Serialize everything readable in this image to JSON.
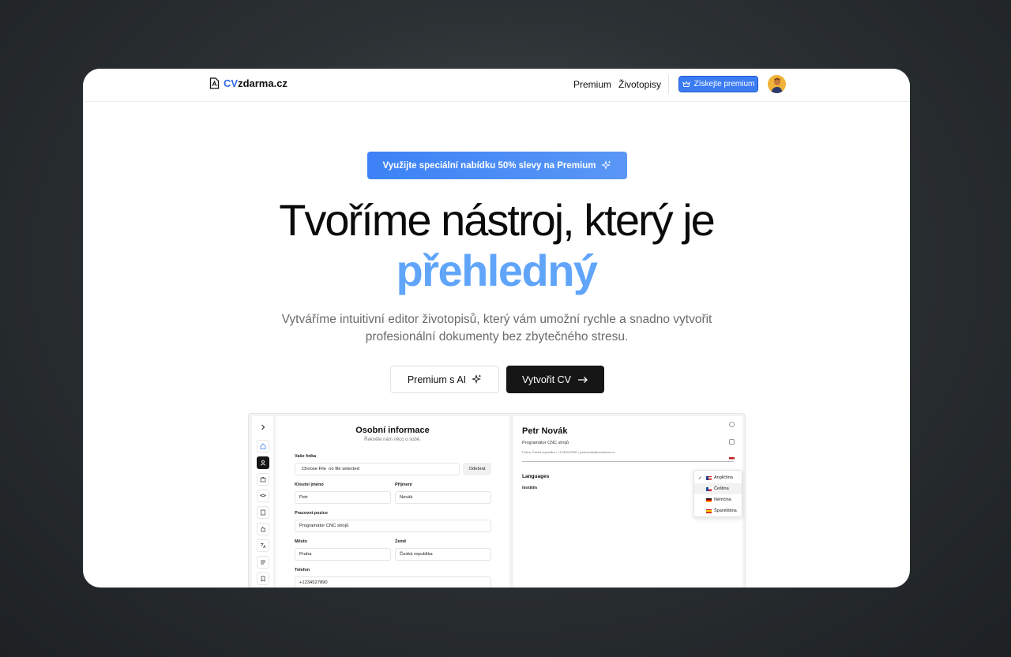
{
  "header": {
    "logo_prefix": "CV",
    "logo_suffix": "zdarma.cz",
    "nav": [
      "Premium",
      "Životopisy"
    ],
    "premium_button": "Získejte premium",
    "colors": {
      "brand": "#2f6ae6",
      "premium_button": "#3b7cf3"
    }
  },
  "hero": {
    "promo": "Využijte speciální nabídku 50% slevy na Premium",
    "headline_line1": "Tvoříme nástroj, který je",
    "headline_line2": "přehledný",
    "subtext": "Vytváříme intuitivní editor životopisů, který vám umožní rychle a snadno vytvořit profesionální dokumenty bez zbytečného stresu.",
    "cta_secondary": "Premium s AI",
    "cta_primary": "Vytvořit CV",
    "accent_color": "#60a5fa"
  },
  "editor": {
    "sidebar_icons": [
      "chevron-right-icon",
      "home-icon",
      "person-icon",
      "briefcase-icon",
      "graduation-cap-icon",
      "document-icon",
      "hand-icon",
      "translate-icon",
      "lines-icon",
      "bookmark-icon"
    ],
    "form_title": "Osobní informace",
    "form_subtitle": "Řekněte nám něco o sobě.",
    "photo_label": "Vaše fotka",
    "choose_file": "Choose File",
    "no_file": "no file selected",
    "remove": "Odebrat",
    "first_name_label": "Křestní jméno",
    "first_name_value": "Petr",
    "last_name_label": "Příjmení",
    "last_name_value": "Novák",
    "position_label": "Pracovní pozice",
    "position_value": "Programátor CNC strojů",
    "city_label": "Město",
    "city_value": "Praha",
    "country_label": "Země",
    "country_value": "Česká republika",
    "phone_label": "Telefon",
    "phone_value": "+1234527890"
  },
  "cv_preview": {
    "name": "Petr Novák",
    "title": "Programátor CNC strojů",
    "contact": "Praha, Česká republika • +1234527890 • petrnovak@cvzdarma.cz",
    "section": "Languages",
    "item": "fdsfdfdfs"
  },
  "language_menu": {
    "options": [
      "Angličtina",
      "Čeština",
      "Němčina",
      "Španělština"
    ],
    "selected": "Angličtina"
  }
}
